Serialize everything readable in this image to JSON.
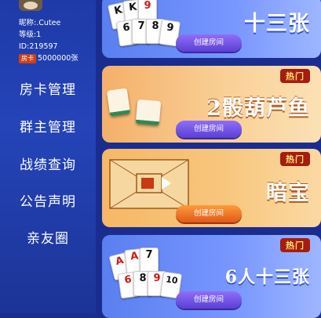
{
  "user": {
    "nickname": "昵称:.Cutee",
    "level": "等级:1",
    "id": "ID:219597",
    "room_badge": "房卡",
    "room_cards": "5000000张"
  },
  "menu": [
    "房卡管理",
    "群主管理",
    "战绩查询",
    "公告声明",
    "亲友圈"
  ],
  "games": [
    {
      "title": "十三张",
      "button": "创建房间"
    },
    {
      "hot": "热门",
      "title": "2骰葫芦鱼",
      "button": "创建房间"
    },
    {
      "hot": "热门",
      "title": "暗宝",
      "button": "创建房间"
    },
    {
      "hot": "热门",
      "title": "6人十三张",
      "button": "创建房间"
    }
  ],
  "cards_top": [
    "K",
    "K",
    "9",
    "6",
    "7",
    "8",
    "9"
  ],
  "cards_bottom": [
    "A",
    "A",
    "7",
    "6",
    "8",
    "9",
    "10"
  ],
  "colors": {
    "sidebar": "#2444b8",
    "orange_card": "#f6b764",
    "purple_button": "#6a4fe0"
  }
}
